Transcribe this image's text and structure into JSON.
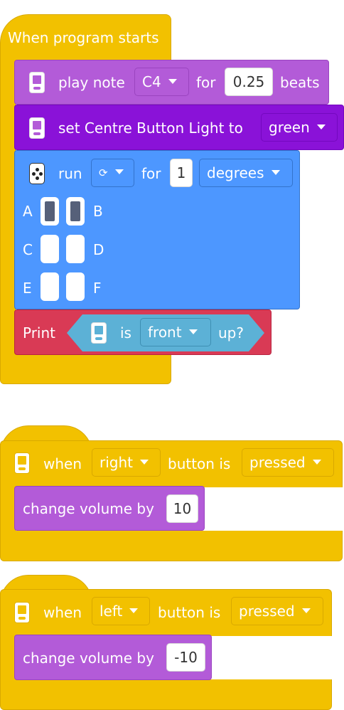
{
  "stack1": {
    "hat_label": "When program starts",
    "play_note": {
      "label": "play note",
      "note": "C4",
      "for": "for",
      "duration": "0.25",
      "beats": "beats"
    },
    "set_light": {
      "label": "set Centre Button Light to",
      "color": "green"
    },
    "motor_run": {
      "run": "run",
      "direction_symbol": "⟳",
      "for": "for",
      "amount": "1",
      "unit": "degrees",
      "ports": [
        "A",
        "B",
        "C",
        "D",
        "E",
        "F"
      ],
      "selected_ports": [
        "A",
        "B"
      ]
    },
    "print": {
      "label": "Print",
      "is": "is",
      "face": "front",
      "up": "up?"
    }
  },
  "stack2": {
    "when": "when",
    "button": "right",
    "button_is": "button is",
    "state": "pressed",
    "change_label": "change volume by",
    "value": "10"
  },
  "stack3": {
    "when": "when",
    "button": "left",
    "button_is": "button is",
    "state": "pressed",
    "change_label": "change volume by",
    "value": "-10"
  },
  "colors": {
    "event": "#F2C100",
    "sound": "#B35BD8",
    "light": "#8A12D8",
    "motor": "#4D97FF",
    "print": "#D93A55",
    "sensor": "#5CB1D6"
  },
  "icons": [
    "hub-icon",
    "motor-icon",
    "caret-down-icon",
    "rotate-clockwise-icon"
  ]
}
